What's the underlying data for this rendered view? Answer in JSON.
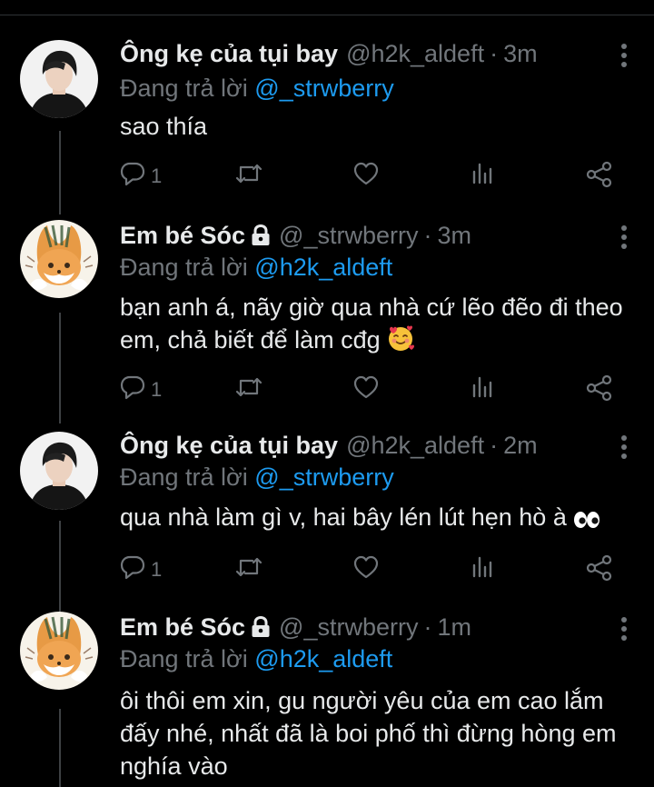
{
  "tweets": [
    {
      "author": "Ông kẹ của tụi bay",
      "handle": "@h2k_aldeft",
      "separator": "·",
      "time": "3m",
      "replying_prefix": "Đang trả lời",
      "replying_to": "@_strwberry",
      "text": "sao thía",
      "reply_count": "1",
      "locked": false,
      "avatar": "boy-photo"
    },
    {
      "author": "Em bé Sóc",
      "handle": "@_strwberry",
      "separator": "·",
      "time": "3m",
      "replying_prefix": "Đang trả lời",
      "replying_to": "@h2k_aldeft",
      "text": "bạn anh á, nãy giờ qua nhà cứ lẽo đẽo đi theo em, chả biết để làm cđg",
      "emoji": "smiling-face-with-hearts",
      "reply_count": "1",
      "locked": true,
      "avatar": "fox-drawing"
    },
    {
      "author": "Ông kẹ của tụi bay",
      "handle": "@h2k_aldeft",
      "separator": "·",
      "time": "2m",
      "replying_prefix": "Đang trả lời",
      "replying_to": "@_strwberry",
      "text": "qua nhà làm gì v, hai bây lén lút hẹn hò à",
      "emoji": "eyes",
      "reply_count": "1",
      "locked": false,
      "avatar": "boy-photo"
    },
    {
      "author": "Em bé Sóc",
      "handle": "@_strwberry",
      "separator": "·",
      "time": "1m",
      "replying_prefix": "Đang trả lời",
      "replying_to": "@h2k_aldeft",
      "text": "ôi thôi em xin, gu người yêu của em cao lắm đấy nhé, nhất đã là boi phố thì đừng hòng em nghía vào",
      "locked": true,
      "avatar": "fox-drawing"
    }
  ],
  "icons": {
    "reply": "reply-icon",
    "retweet": "retweet-icon",
    "like": "like-icon",
    "analytics": "analytics-icon",
    "share": "share-icon",
    "more": "more-options-icon",
    "lock": "lock-icon"
  },
  "colors": {
    "background": "#000000",
    "text": "#e7e9ea",
    "muted": "#71767b",
    "link": "#1d9bf0"
  }
}
